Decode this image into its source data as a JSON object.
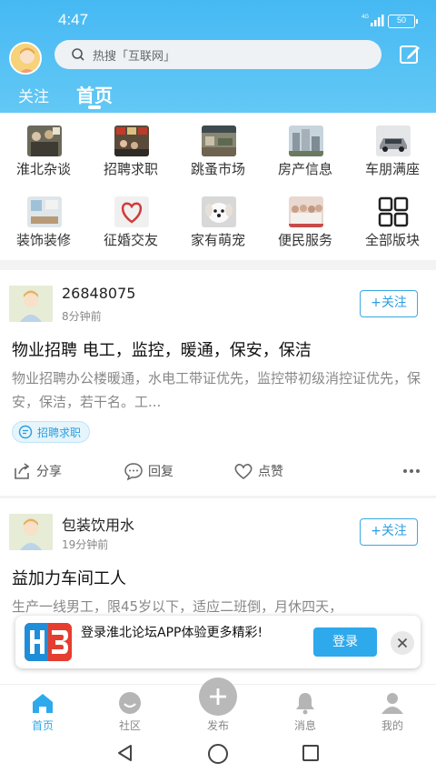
{
  "status_bar": {
    "time": "4:47",
    "network": "4G",
    "battery": "50"
  },
  "header": {
    "search_placeholder": "热搜「互联网」",
    "tabs": [
      {
        "label": "关注"
      },
      {
        "label": "首页"
      }
    ],
    "accent_color": "#46b9f3"
  },
  "categories": [
    {
      "label": "淮北杂谈",
      "icon": "crowd-photo"
    },
    {
      "label": "招聘求职",
      "icon": "job-fair-photo"
    },
    {
      "label": "跳蚤市场",
      "icon": "market-photo"
    },
    {
      "label": "房产信息",
      "icon": "buildings-photo"
    },
    {
      "label": "车朋满座",
      "icon": "car-photo"
    },
    {
      "label": "装饰装修",
      "icon": "interior-photo"
    },
    {
      "label": "征婚交友",
      "icon": "heart-photo"
    },
    {
      "label": "家有萌宠",
      "icon": "puppy-photo"
    },
    {
      "label": "便民服务",
      "icon": "group-photo"
    },
    {
      "label": "全部版块",
      "icon": "grid-icon"
    }
  ],
  "posts": [
    {
      "user": "26848075",
      "time": "8分钟前",
      "follow_label": "+关注",
      "title": "物业招聘 电工，监控，暖通，保安，保洁",
      "body": "物业招聘办公楼暖通，水电工带证优先，监控带初级消控证优先，保安，保洁，若干名。工...",
      "tag": "招聘求职",
      "actions": {
        "share": "分享",
        "reply": "回复",
        "like": "点赞"
      }
    },
    {
      "user": "包装饮用水",
      "time": "19分钟前",
      "follow_label": "+关注",
      "title": "益加力车间工人",
      "body": "生产一线男工，限45岁以下，适应二班倒，月休四天，"
    }
  ],
  "login_banner": {
    "text": "登录淮北论坛APP体验更多精彩!",
    "button": "登录"
  },
  "bottom_nav": [
    {
      "label": "首页",
      "icon": "home-icon",
      "active": true
    },
    {
      "label": "社区",
      "icon": "community-icon"
    },
    {
      "label": "发布",
      "icon": "plus-icon"
    },
    {
      "label": "消息",
      "icon": "bell-icon"
    },
    {
      "label": "我的",
      "icon": "profile-icon"
    }
  ]
}
